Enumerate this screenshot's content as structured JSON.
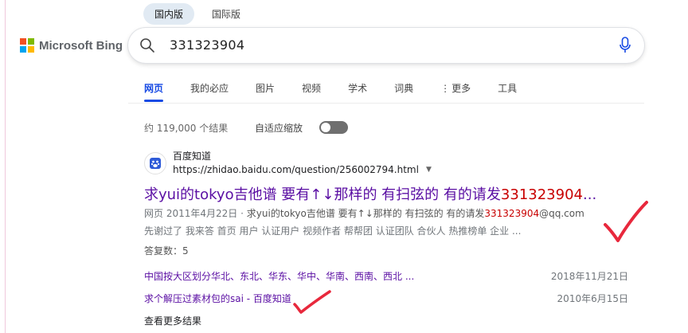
{
  "market_tabs": [
    {
      "label": "国内版",
      "active": true
    },
    {
      "label": "国际版",
      "active": false
    }
  ],
  "logo": {
    "text": "Microsoft Bing"
  },
  "search": {
    "query": "331323904"
  },
  "scopes": [
    {
      "label": "网页",
      "active": true
    },
    {
      "label": "我的必应",
      "active": false
    },
    {
      "label": "图片",
      "active": false
    },
    {
      "label": "视频",
      "active": false
    },
    {
      "label": "学术",
      "active": false
    },
    {
      "label": "词典",
      "active": false
    },
    {
      "label": "更多",
      "active": false
    },
    {
      "label": "工具",
      "active": false
    }
  ],
  "results_info": {
    "count": "约 119,000 个结果",
    "adaptive_label": "自适应缩放"
  },
  "result": {
    "site_name": "百度知道",
    "url": "https://zhidao.baidu.com/question/256002794.html",
    "title_pre": "求yui的tokyo吉他谱 要有↑↓那样的 有扫弦的 有的请发",
    "title_hl": "331323904",
    "title_post": "...",
    "meta_prefix": "网页",
    "meta_date": "2011年4月22日",
    "meta_sep": "·",
    "snippet_pre": "求yui的tokyo吉他谱 要有↑↓那样的 有扫弦的 有的请发",
    "snippet_hl": "331323904",
    "snippet_post": "@qq.com",
    "snippet_line2": "先谢过了 我来答 首页 用户 认证用户 视频作者 帮帮团 认证团队 合伙人 热推榜单 企业 ...",
    "answers": "答复数：5",
    "related": [
      {
        "title": "中国按大区划分华北、东北、华东、华中、华南、西南、西北 ...",
        "date": "2018年11月21日"
      },
      {
        "title": "求个解压过素材包的sai - 百度知道",
        "date": "2010年6月15日"
      }
    ],
    "more_results": "查看更多结果"
  },
  "colors": {
    "accent": "#174ae4",
    "visited_link": "#5a0ea3",
    "highlight": "#c80000",
    "annotation_red": "#e8283c"
  }
}
